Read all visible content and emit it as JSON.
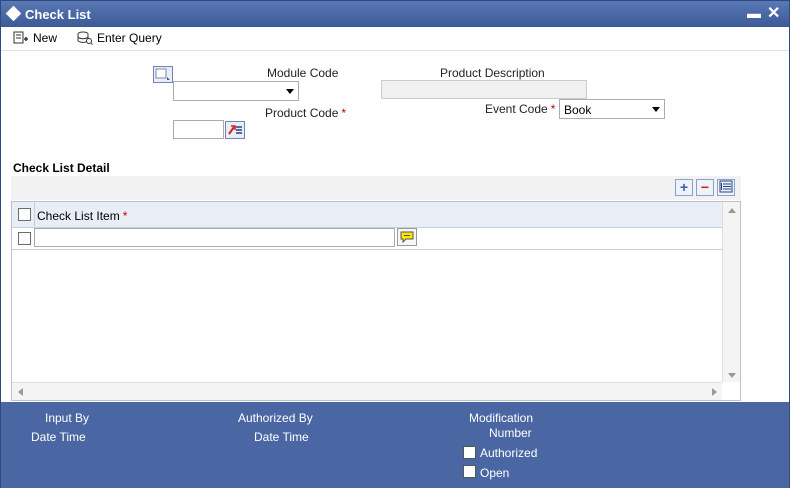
{
  "window": {
    "title": "Check List"
  },
  "toolbar": {
    "new_label": "New",
    "enter_query_label": "Enter Query"
  },
  "form": {
    "module_code_label": "Module Code",
    "module_code_value": "",
    "product_description_label": "Product Description",
    "product_description_value": "",
    "product_code_label": "Product Code",
    "product_code_value": "",
    "event_code_label": "Event Code",
    "event_code_value": "Book",
    "required_mark": "*"
  },
  "checklist": {
    "section_title": "Check List Detail",
    "column_header": "Check List Item",
    "rows": [
      {
        "item": ""
      }
    ]
  },
  "footer": {
    "input_by": "Input By",
    "date_time_1": "Date Time",
    "authorized_by": "Authorized By",
    "date_time_2": "Date Time",
    "modification": "Modification",
    "number": "Number",
    "authorized": "Authorized",
    "open": "Open"
  }
}
